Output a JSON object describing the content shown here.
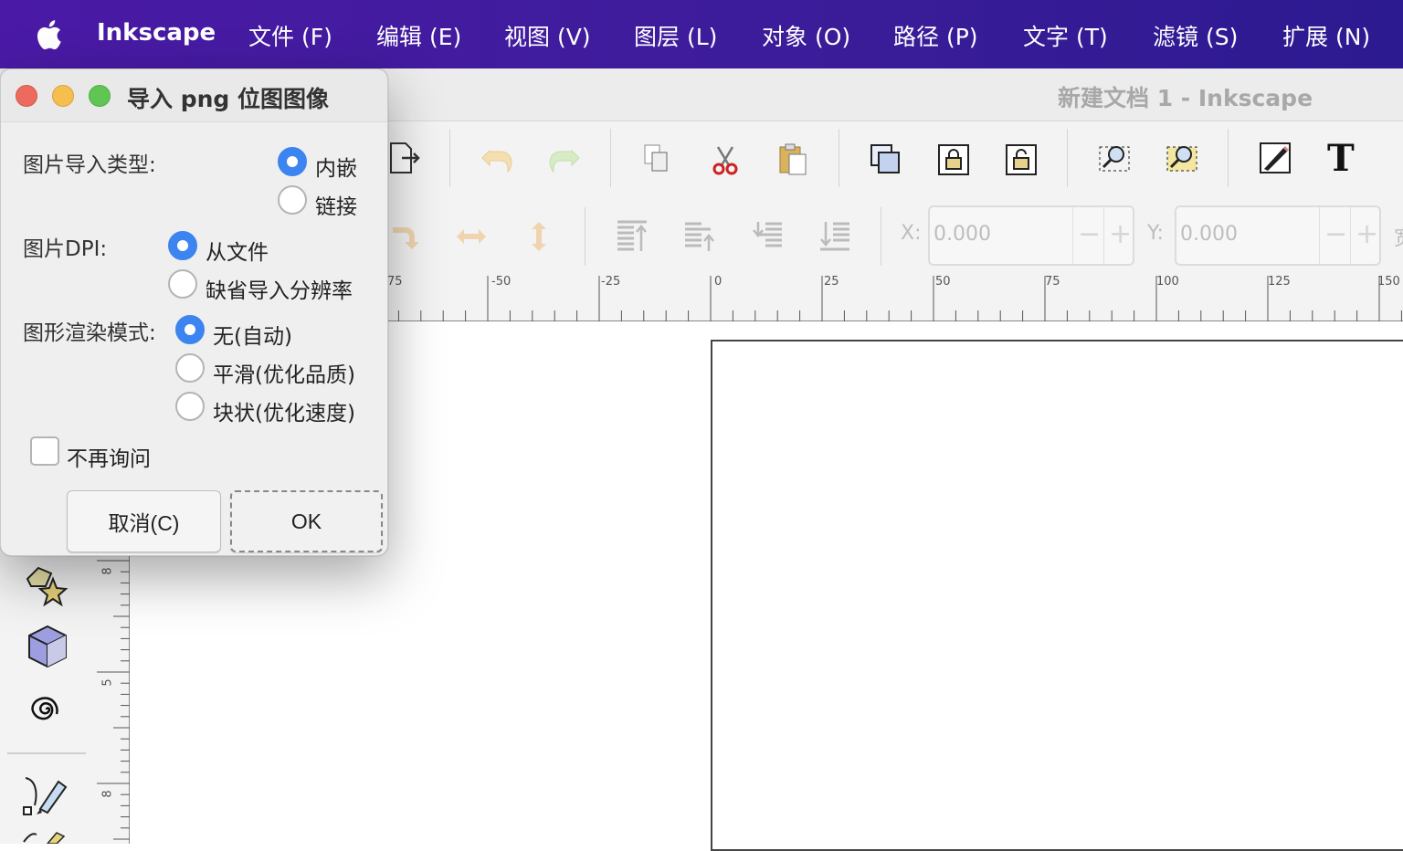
{
  "menubar": {
    "app_name": "Inkscape",
    "items": [
      "文件 (F)",
      "编辑 (E)",
      "视图 (V)",
      "图层 (L)",
      "对象 (O)",
      "路径 (P)",
      "文字 (T)",
      "滤镜 (S)",
      "扩展 (N)"
    ]
  },
  "window": {
    "title": "新建文档 1 - Inkscape"
  },
  "toolbar": {
    "x_label": "X:",
    "x_value": "0.000",
    "y_label": "Y:",
    "y_value": "0.000",
    "w_label": "宽",
    "minus": "−",
    "plus": "+"
  },
  "ruler": {
    "h_labels": [
      "75",
      "-50",
      "-25",
      "0",
      "25",
      "50",
      "75",
      "100",
      "125",
      "150"
    ],
    "v_labels": [
      "8",
      "5",
      "8"
    ]
  },
  "dialog": {
    "title": "导入 png 位图图像",
    "image_import_type_label": "图片导入类型:",
    "import_options": [
      {
        "label": "内嵌",
        "selected": true
      },
      {
        "label": "链接",
        "selected": false
      }
    ],
    "dpi_label": "图片DPI:",
    "dpi_options": [
      {
        "label": "从文件",
        "selected": true
      },
      {
        "label": "缺省导入分辨率",
        "selected": false
      }
    ],
    "render_label": "图形渲染模式:",
    "render_options": [
      {
        "label": "无(自动)",
        "selected": true
      },
      {
        "label": "平滑(优化品质)",
        "selected": false
      },
      {
        "label": "块状(优化速度)",
        "selected": false
      }
    ],
    "dont_ask_label": "不再询问",
    "dont_ask_checked": false,
    "cancel_label": "取消(C)",
    "ok_label": "OK"
  },
  "colors": {
    "menubar_start": "#4a1aa6",
    "menubar_end": "#2c1a90",
    "radio_selected": "#3c84f0",
    "traffic_red": "#ed6a5e",
    "traffic_yellow": "#f5bf4f",
    "traffic_green": "#61c554"
  }
}
